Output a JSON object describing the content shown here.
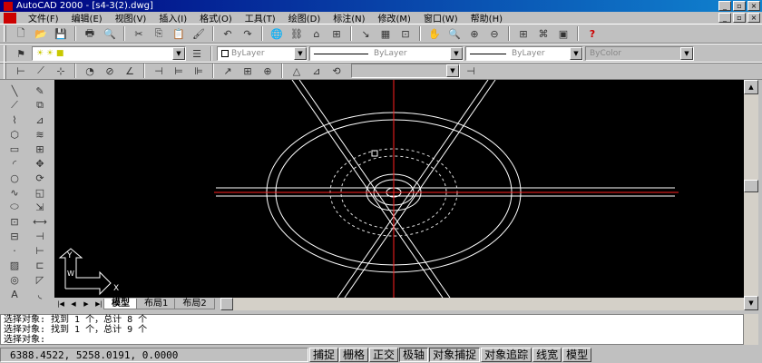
{
  "window": {
    "title": "AutoCAD 2000 - [s4-3(2).dwg]"
  },
  "menu": [
    "文件(F)",
    "编辑(E)",
    "视图(V)",
    "插入(I)",
    "格式(O)",
    "工具(T)",
    "绘图(D)",
    "标注(N)",
    "修改(M)",
    "窗口(W)",
    "帮助(H)"
  ],
  "toolbar_properties": {
    "layer": "",
    "color": "ByLayer",
    "linetype": "ByLayer",
    "lineweight": "ByLayer",
    "plotstyle": "ByColor"
  },
  "drawing": {
    "background": "#000000",
    "centerline_color": "#ff2020",
    "geometry_color": "#ffffff",
    "hidden_color": "#dddddd",
    "ucs_x": "X",
    "ucs_y": "Y",
    "ucs_w": "W"
  },
  "tabs": [
    "模型",
    "布局1",
    "布局2"
  ],
  "command_lines": [
    "选择对象:  找到 1 个，总计 8 个",
    "选择对象:  找到 1 个，总计 9 个",
    "选择对象:"
  ],
  "status": {
    "coords": "6388.4522, 5258.0191, 0.0000",
    "buttons": [
      "捕捉",
      "栅格",
      "正交",
      "极轴",
      "对象捕捉",
      "对象追踪",
      "线宽",
      "模型"
    ]
  }
}
